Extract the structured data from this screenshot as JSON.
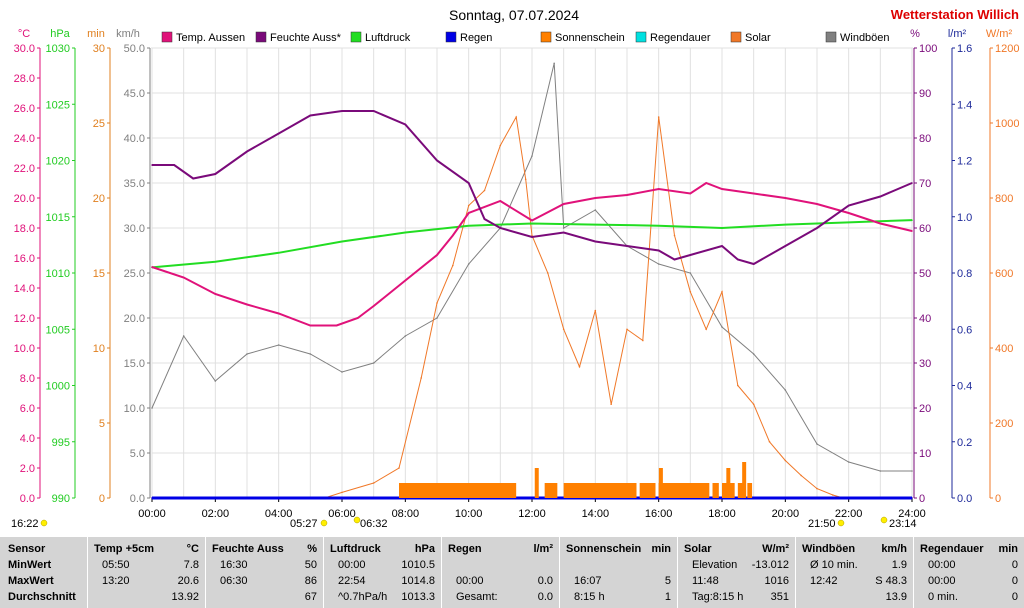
{
  "header": {
    "title": "Sonntag, 07.07.2024",
    "station": "Wetterstation Willich"
  },
  "colors": {
    "temp": "#e0127a",
    "humidity": "#7a0a7a",
    "pressure": "#22dd22",
    "rain": "#0000e6",
    "sunshine": "#ff8000",
    "rain_duration": "#00e0e0",
    "solar": "#f07828",
    "gust": "#808080",
    "axis_temp": "#e0127a",
    "axis_pressure": "#22cc22",
    "axis_min": "#e08020",
    "axis_kmh": "#808080",
    "axis_pct": "#7a0a7a",
    "axis_lm2": "#1e2a9a",
    "axis_wm2": "#f07828",
    "grid": "#e0e0e0",
    "station": "#dd0000"
  },
  "legend": [
    {
      "key": "temp",
      "label": "Temp. Aussen",
      "icon": "legend-square"
    },
    {
      "key": "humidity",
      "label": "Feuchte Auss*",
      "icon": "legend-square"
    },
    {
      "key": "pressure",
      "label": "Luftdruck",
      "icon": "legend-square"
    },
    {
      "key": "rain",
      "label": "Regen",
      "icon": "legend-square"
    },
    {
      "key": "sunshine",
      "label": "Sonnenschein",
      "icon": "legend-square"
    },
    {
      "key": "rain_duration",
      "label": "Regendauer",
      "icon": "legend-square"
    },
    {
      "key": "solar",
      "label": "Solar",
      "icon": "legend-square"
    },
    {
      "key": "gust",
      "label": "Windböen",
      "icon": "legend-square"
    }
  ],
  "axes_units": {
    "temp": "°C",
    "pressure": "hPa",
    "minutes": "min",
    "kmh": "km/h",
    "percent": "%",
    "lm2": "l/m²",
    "wm2": "W/m²"
  },
  "chart_data": {
    "type": "line",
    "title": "Sonntag, 07.07.2024",
    "x_ticks": [
      "00:00",
      "02:00",
      "04:00",
      "06:00",
      "08:00",
      "10:00",
      "12:00",
      "14:00",
      "16:00",
      "18:00",
      "20:00",
      "22:00",
      "24:00"
    ],
    "x_range_hours": [
      0,
      24
    ],
    "grid": true,
    "legend_placement": "top",
    "axes": {
      "temp": {
        "range": [
          0,
          30
        ],
        "ticks": [
          "0.0",
          "2.0",
          "4.0",
          "6.0",
          "8.0",
          "10.0",
          "12.0",
          "14.0",
          "16.0",
          "18.0",
          "20.0",
          "22.0",
          "24.0",
          "26.0",
          "28.0",
          "30.0"
        ]
      },
      "pressure": {
        "range": [
          990,
          1030
        ],
        "ticks": [
          "990",
          "995",
          "1000",
          "1005",
          "1010",
          "1015",
          "1020",
          "1025",
          "1030"
        ]
      },
      "minutes": {
        "range": [
          0,
          30
        ],
        "ticks": [
          "0",
          "5",
          "10",
          "15",
          "20",
          "25",
          "30"
        ]
      },
      "kmh": {
        "range": [
          0,
          50
        ],
        "ticks": [
          "0.0",
          "5.0",
          "10.0",
          "15.0",
          "20.0",
          "25.0",
          "30.0",
          "35.0",
          "40.0",
          "45.0",
          "50.0"
        ]
      },
      "percent": {
        "range": [
          0,
          100
        ],
        "ticks": [
          "0",
          "10",
          "20",
          "30",
          "40",
          "50",
          "60",
          "70",
          "80",
          "90",
          "100"
        ]
      },
      "lm2": {
        "range": [
          0,
          1.6
        ],
        "ticks": [
          "0.0",
          "0.2",
          "0.4",
          "0.6",
          "0.8",
          "1.0",
          "1.2",
          "1.4",
          "1.6"
        ]
      },
      "wm2": {
        "range": [
          0,
          1200
        ],
        "ticks": [
          "0",
          "200",
          "400",
          "600",
          "800",
          "1000",
          "1200"
        ]
      }
    },
    "series": [
      {
        "name": "Temp. Aussen",
        "key": "temp",
        "axis": "temp",
        "hours": [
          0,
          1,
          2,
          3,
          4,
          5,
          5.83,
          6.5,
          7,
          8,
          9,
          9.5,
          10,
          11,
          12,
          13,
          14,
          15,
          16,
          17,
          17.5,
          18,
          19,
          20,
          21,
          22,
          23,
          24
        ],
        "values": [
          15.4,
          14.7,
          13.6,
          12.9,
          12.3,
          11.5,
          11.5,
          12.0,
          12.8,
          14.5,
          16.2,
          17.5,
          19.0,
          19.8,
          18.5,
          19.6,
          20.0,
          20.2,
          20.6,
          20.3,
          21.0,
          20.6,
          20.3,
          20.0,
          19.6,
          19.0,
          18.3,
          17.8
        ]
      },
      {
        "name": "Feuchte Auss*",
        "key": "humidity",
        "axis": "percent",
        "hours": [
          0,
          0.7,
          1.3,
          2,
          3,
          4,
          5,
          6,
          6.5,
          7,
          8,
          9,
          10,
          10.5,
          11,
          12,
          13,
          14,
          15,
          16,
          16.5,
          17,
          18,
          18.5,
          19,
          20,
          21,
          22,
          23,
          24
        ],
        "values": [
          74,
          74,
          71,
          72,
          77,
          81,
          85,
          86,
          86,
          86,
          83,
          75,
          70,
          62,
          60,
          58,
          59,
          57,
          56,
          55,
          53,
          54,
          56,
          53,
          52,
          56,
          60,
          65,
          67,
          70
        ]
      },
      {
        "name": "Luftdruck",
        "key": "pressure",
        "axis": "pressure",
        "hours": [
          0,
          2,
          4,
          6,
          8,
          10,
          12,
          14,
          16,
          18,
          20,
          22,
          24
        ],
        "values": [
          1010.5,
          1011.0,
          1011.8,
          1012.8,
          1013.6,
          1014.2,
          1014.4,
          1014.3,
          1014.2,
          1014.0,
          1014.3,
          1014.5,
          1014.7
        ]
      },
      {
        "name": "Regen",
        "key": "rain",
        "axis": "lm2",
        "hours": [
          0,
          24
        ],
        "values": [
          0.0,
          0.0
        ]
      },
      {
        "name": "Solar",
        "key": "solar",
        "axis": "wm2",
        "hours": [
          0,
          5.45,
          6,
          7,
          7.8,
          8.5,
          9,
          9.5,
          10,
          10.5,
          11,
          11.5,
          11.8,
          12,
          12.5,
          13,
          13.5,
          14,
          14.5,
          15,
          15.5,
          16,
          16.5,
          17,
          17.5,
          18,
          18.5,
          19,
          19.5,
          20,
          20.5,
          21,
          21.5,
          21.83,
          24
        ],
        "values": [
          0,
          0,
          15,
          40,
          80,
          320,
          520,
          620,
          780,
          820,
          940,
          1016,
          850,
          700,
          600,
          450,
          350,
          500,
          250,
          450,
          420,
          1016,
          700,
          550,
          450,
          550,
          300,
          250,
          150,
          100,
          60,
          25,
          8,
          0,
          0
        ]
      },
      {
        "name": "Windböen",
        "key": "gust",
        "axis": "kmh",
        "hours": [
          0,
          1,
          2,
          3,
          4,
          5,
          6,
          7,
          8,
          9,
          10,
          11,
          12,
          12.7,
          13,
          14,
          15,
          16,
          17,
          18,
          19,
          20,
          21,
          22,
          23,
          24
        ],
        "values": [
          10,
          18,
          13,
          16,
          17,
          16,
          14,
          15,
          18,
          20,
          26,
          30,
          38,
          48.3,
          30,
          32,
          28,
          26,
          25,
          19,
          16,
          12,
          6,
          4,
          3,
          3
        ]
      }
    ],
    "sunshine_blocks": [
      [
        7.8,
        11.5
      ],
      [
        12.4,
        12.8
      ],
      [
        13.0,
        15.3
      ],
      [
        15.4,
        15.9
      ],
      [
        16.0,
        17.6
      ],
      [
        17.7,
        17.9
      ],
      [
        18.0,
        18.4
      ],
      [
        18.5,
        18.7
      ],
      [
        18.8,
        18.95
      ]
    ],
    "sunshine_spikes": [
      {
        "hour": 12.15,
        "minutes": 5
      },
      {
        "hour": 16.07,
        "minutes": 5
      },
      {
        "hour": 18.2,
        "minutes": 5
      },
      {
        "hour": 18.7,
        "minutes": 6
      }
    ]
  },
  "sun_markers": [
    {
      "label": "16:22",
      "kind": "moon"
    },
    {
      "label": "05:27",
      "kind": "dawn"
    },
    {
      "label": "06:32",
      "kind": "sunrise"
    },
    {
      "label": "21:50",
      "kind": "sunset"
    },
    {
      "label": "23:14",
      "kind": "dusk"
    }
  ],
  "stats": {
    "rows": [
      "Sensor",
      "MinWert",
      "MaxWert",
      "Durchschnitt"
    ],
    "columns": [
      {
        "title": "Temp +5cm",
        "unit": "°C",
        "cells": [
          [
            "05:50",
            "7.8"
          ],
          [
            "13:20",
            "20.6"
          ],
          [
            "",
            "13.92"
          ]
        ]
      },
      {
        "title": "Feuchte Auss",
        "unit": "%",
        "cells": [
          [
            "16:30",
            "50"
          ],
          [
            "06:30",
            "86"
          ],
          [
            "",
            "67"
          ]
        ]
      },
      {
        "title": "Luftdruck",
        "unit": "hPa",
        "cells": [
          [
            "00:00",
            "1010.5"
          ],
          [
            "22:54",
            "1014.8"
          ],
          [
            "^0.7hPa/h",
            "1013.3"
          ]
        ]
      },
      {
        "title": "Regen",
        "unit": "l/m²",
        "cells": [
          [
            "",
            ""
          ],
          [
            "00:00",
            "0.0"
          ],
          [
            "Gesamt:",
            "0.0"
          ]
        ]
      },
      {
        "title": "Sonnenschein",
        "unit": "min",
        "cells": [
          [
            "",
            ""
          ],
          [
            "16:07",
            "5"
          ],
          [
            "8:15 h",
            "1"
          ]
        ]
      },
      {
        "title": "Solar",
        "unit": "W/m²",
        "cells": [
          [
            "Elevation",
            "-13.012"
          ],
          [
            "11:48",
            "1016"
          ],
          [
            "Tag:8:15 h",
            "351"
          ]
        ]
      },
      {
        "title": "Windböen",
        "unit": "km/h",
        "cells": [
          [
            "Ø 10 min.",
            "1.9"
          ],
          [
            "12:42",
            "S 48.3"
          ],
          [
            "",
            "13.9"
          ]
        ]
      },
      {
        "title": "Regendauer",
        "unit": "min",
        "cells": [
          [
            "00:00",
            "0"
          ],
          [
            "00:00",
            "0"
          ],
          [
            "0 min.",
            "0"
          ]
        ]
      }
    ]
  }
}
